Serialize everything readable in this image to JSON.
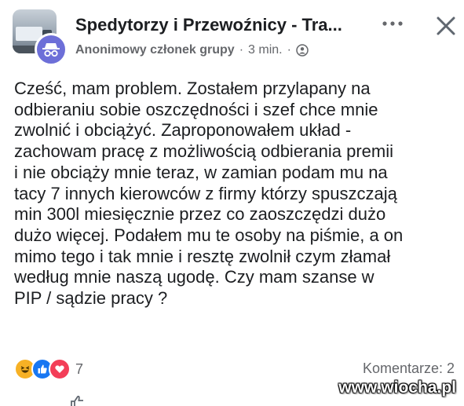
{
  "post_header": {
    "group_name": "Spedytorzy i Przewoźnicy - Tra...",
    "author": "Anonimowy członek grupy",
    "separator_1": "·",
    "timestamp": "3 min.",
    "separator_2": "·",
    "privacy_icon": "group-privacy-icon",
    "more_icon": "more-dots-icon",
    "close_icon": "close-icon"
  },
  "post": {
    "text": "Cześć, mam problem. Zostałem przylapany na\nodbieraniu sobie oszczędności i szef chce mnie\nzwolnić i obciążyć. Zaproponowałem układ -\nzachowam pracę z możliwością odbierania premii\ni nie obciąży mnie teraz, w zamian podam mu na\ntacy 7 innych kierowców z firmy którzy spuszczają\nmin 300l miesięcznie przez co zaoszczędzi dużo\ndużo więcej. Podałem mu te osoby na piśmie, a on\nmimo tego i tak mnie i resztę zwolnił czym złamał\nwedług mnie naszą ugodę. Czy mam szanse w\nPIP / sądzie pracy ?"
  },
  "footer": {
    "reactions": [
      "haha",
      "like",
      "love"
    ],
    "reaction_count": "7",
    "comments": "Komentarze: 2"
  },
  "watermark": "www.wiocha.pl",
  "colors": {
    "text": "#1c1e21",
    "secondary": "#65676b",
    "avatar_bg": "#6d6fd8",
    "like_blue": "#1877f2",
    "love_red": "#f33e58",
    "haha_yellow": "#f7b125"
  }
}
